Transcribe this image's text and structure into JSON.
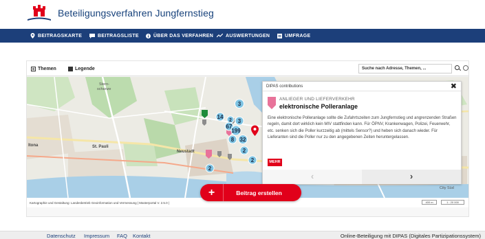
{
  "header": {
    "title": "Beteiligungsverfahren Jungfernstieg"
  },
  "nav": {
    "items": [
      {
        "label": "BEITRAGSKARTE",
        "icon": "map-marker-icon"
      },
      {
        "label": "BEITRAGSLISTE",
        "icon": "speech-bubble-icon"
      },
      {
        "label": "ÜBER DAS VERFAHREN",
        "icon": "info-icon"
      },
      {
        "label": "AUSWERTUNGEN",
        "icon": "chart-line-icon"
      },
      {
        "label": "UMFRAGE",
        "icon": "survey-icon"
      }
    ]
  },
  "map_toolbar": {
    "themes": "Themen",
    "legend": "Legende",
    "search_placeholder": "Suche nach Adresse, Themen, ..."
  },
  "map": {
    "labels": {
      "stern": "Stern-",
      "schanze": "schanze",
      "stpauli": "St. Pauli",
      "neustadt": "Neustadt",
      "altona": "ltona",
      "city": "City Süd"
    },
    "clusters": [
      "3",
      "14",
      "2",
      "67",
      "199",
      "3",
      "8",
      "32",
      "2",
      "2",
      "2"
    ],
    "attribution": "Kartographie und Gestaltung: Landesbetrieb Geoinformation und Vermessung  |  Masterportal V. 2.5.0  |",
    "scale": "400 m",
    "ratio": "1 : 20 000"
  },
  "popup": {
    "header": "DIPAS contributions",
    "close": "✖",
    "category": "ANLIEGER UND LIEFERVERKEHR",
    "title": "elektronische Polleranlage",
    "body": "Eine elektronische Polleranlage sollte die Zufahrtszeiten zum Jungfernstieg und angrenzenden Straßen regeln, damit dort wirklich kein MIV stattfinden kann. Für ÖPNV, Krankenwagen, Polizei, Feuerwehr, etc. senken sich die Poller kurzzeitig ab (mittels Sensor?) und heben sich danach wieder. Für Lieferanten sind die Poller nur zu den angegebenen Zeiten heruntergelassen.",
    "more": "MEHR",
    "prev": "‹",
    "next": "›"
  },
  "cta": {
    "plus": "+",
    "label": "Beitrag erstellen"
  },
  "footer": {
    "links": [
      "Datenschutz",
      "Impressum",
      "FAQ",
      "Kontakt"
    ],
    "right": "Online-Beteiligung mit DIPAS (Digitales Partizipationssystem)"
  },
  "colors": {
    "brand_blue": "#1c3f7a",
    "brand_red": "#e1001a",
    "category_pink": "#e8739a",
    "cluster_blue": "#7fc4e3"
  }
}
